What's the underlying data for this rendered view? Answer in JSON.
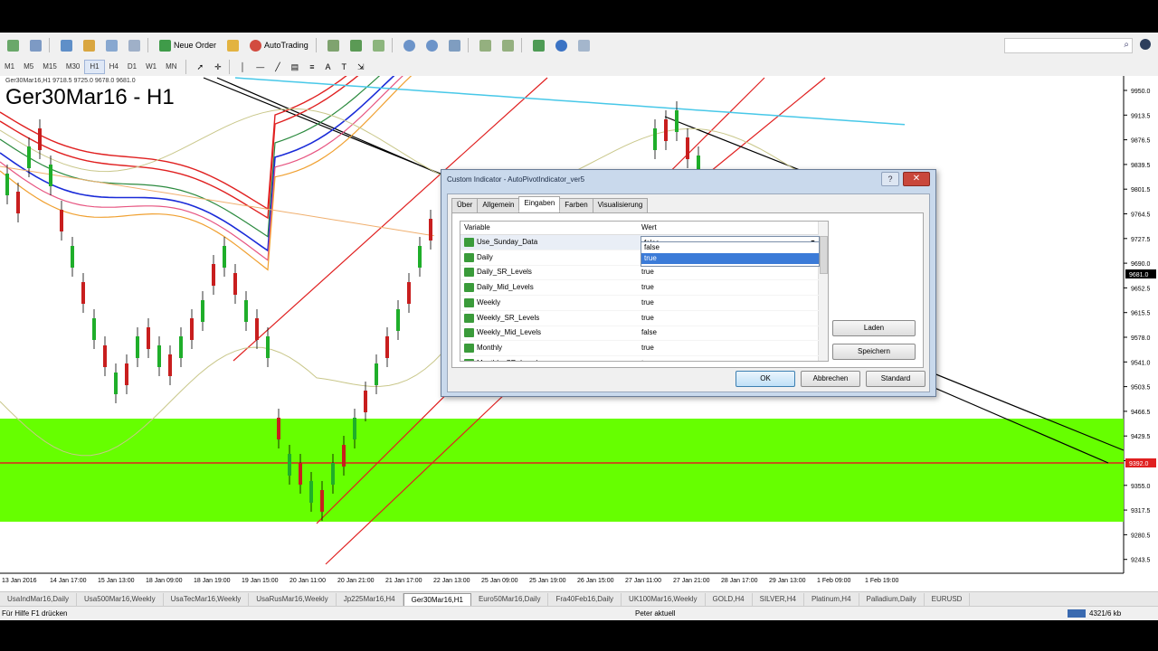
{
  "toolbar": {
    "new_order": "Neue Order",
    "auto_trading": "AutoTrading",
    "timeframes": [
      "M1",
      "M5",
      "M15",
      "M30",
      "H1",
      "H4",
      "D1",
      "W1",
      "MN"
    ],
    "active_timeframe": "H1"
  },
  "chart": {
    "info": "Ger30Mar16,H1  9718.5 9725.0 9678.0 9681.0",
    "title": "Ger30Mar16 - H1",
    "price_labels": [
      "9950.0",
      "9913.5",
      "9876.5",
      "9839.5",
      "9801.5",
      "9764.5",
      "9727.5",
      "9690.0",
      "9652.5",
      "9615.5",
      "9578.0",
      "9541.0",
      "9503.5",
      "9466.5",
      "9429.5",
      "9392.0",
      "9355.0",
      "9317.5",
      "9280.5",
      "9243.5"
    ],
    "current_price": "9681.0",
    "red_line_price": "9392.0",
    "date_labels": [
      "13 Jan 2016",
      "14 Jan 17:00",
      "15 Jan 13:00",
      "18 Jan 09:00",
      "18 Jan 19:00",
      "19 Jan 15:00",
      "20 Jan 11:00",
      "20 Jan 21:00",
      "21 Jan 17:00",
      "22 Jan 13:00",
      "25 Jan 09:00",
      "25 Jan 19:00",
      "26 Jan 15:00",
      "27 Jan 11:00",
      "27 Jan 21:00",
      "28 Jan 17:00",
      "29 Jan 13:00",
      "1 Feb 09:00",
      "1 Feb 19:00"
    ]
  },
  "bottom_tabs": [
    "UsaIndMar16,Daily",
    "Usa500Mar16,Weekly",
    "UsaTecMar16,Weekly",
    "UsaRusMar16,Weekly",
    "Jp225Mar16,H4",
    "Ger30Mar16,H1",
    "Euro50Mar16,Daily",
    "Fra40Feb16,Daily",
    "UK100Mar16,Weekly",
    "GOLD,H4",
    "SILVER,H4",
    "Platinum,H4",
    "Palladium,Daily",
    "EURUSD"
  ],
  "active_bottom_tab": "Ger30Mar16,H1",
  "status": {
    "help": "Für Hilfe F1 drücken",
    "profile": "Peter aktuell",
    "traffic": "4321/6 kb"
  },
  "dialog": {
    "title": "Custom Indicator - AutoPivotIndicator_ver5",
    "help": "?",
    "close": "✕",
    "tabs": [
      "Über",
      "Allgemein",
      "Eingaben",
      "Farben",
      "Visualisierung"
    ],
    "active_tab": "Eingaben",
    "col_variable": "Variable",
    "col_value": "Wert",
    "params": [
      {
        "name": "Use_Sunday_Data",
        "value": "false"
      },
      {
        "name": "Daily",
        "value": "true"
      },
      {
        "name": "Daily_SR_Levels",
        "value": "true"
      },
      {
        "name": "Daily_Mid_Levels",
        "value": "true"
      },
      {
        "name": "Weekly",
        "value": "true"
      },
      {
        "name": "Weekly_SR_Levels",
        "value": "true"
      },
      {
        "name": "Weekly_Mid_Levels",
        "value": "false"
      },
      {
        "name": "Monthly",
        "value": "true"
      },
      {
        "name": "Monthly_SR_Levels",
        "value": "true"
      }
    ],
    "dropdown_options": [
      "false",
      "true"
    ],
    "load_button": "Laden",
    "save_button": "Speichern",
    "ok_button": "OK",
    "cancel_button": "Abbrechen",
    "default_button": "Standard"
  }
}
